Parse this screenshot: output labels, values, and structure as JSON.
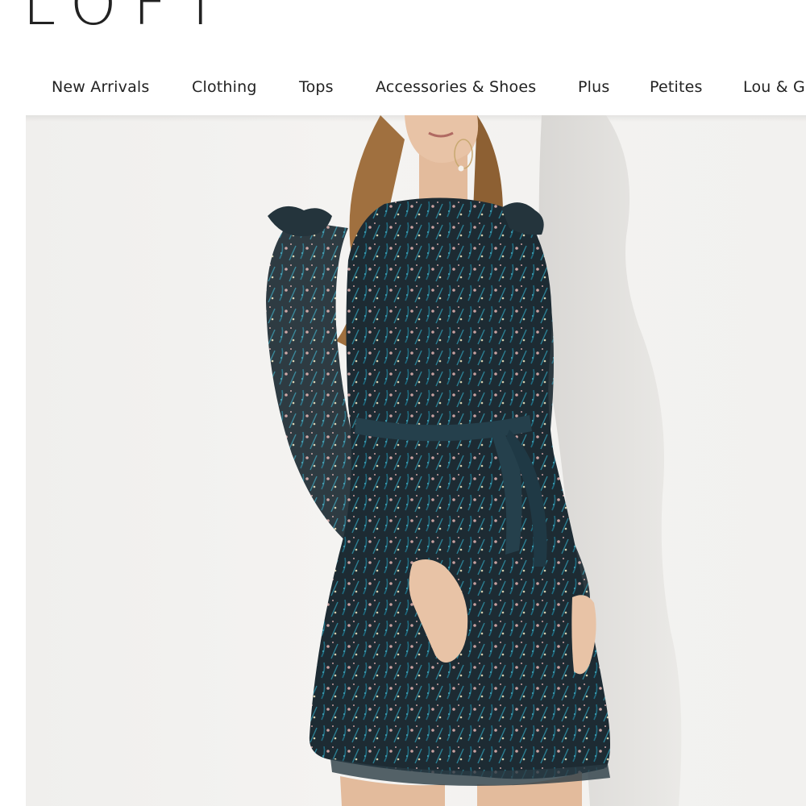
{
  "brand": {
    "logo_text": "LOFT"
  },
  "nav": {
    "items": [
      {
        "label": "New Arrivals"
      },
      {
        "label": "Clothing"
      },
      {
        "label": "Tops"
      },
      {
        "label": "Accessories & Shoes"
      },
      {
        "label": "Plus"
      },
      {
        "label": "Petites"
      },
      {
        "label": "Lou & Grey"
      }
    ]
  },
  "hero": {
    "image": "product-photo",
    "colors": {
      "background": "#f1f0ee",
      "dress": "#1d2b33",
      "print_teal": "#1f6b80",
      "print_pink": "#c9a1a0",
      "hair": "#a0703f",
      "skin": "#e8c3a6"
    }
  }
}
